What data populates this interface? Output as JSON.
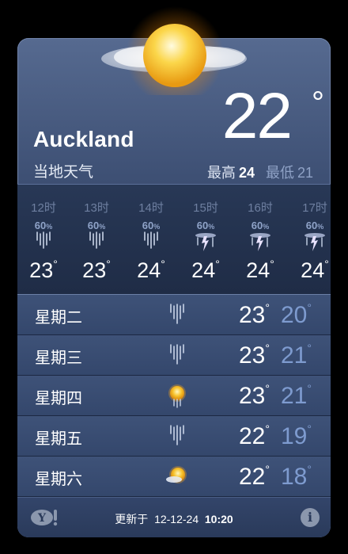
{
  "header": {
    "city": "Auckland",
    "subtitle": "当地天气",
    "temperature": "22",
    "degree_symbol": "°",
    "high_label": "最高",
    "high_value": "24",
    "low_label": "最低",
    "low_value": "21",
    "condition_icon": "partly-cloudy-sun-icon"
  },
  "hourly": [
    {
      "time": "12时",
      "chance": "60",
      "pct": "%",
      "temp": "23",
      "deg": "°",
      "icon": "rain-icon"
    },
    {
      "time": "13时",
      "chance": "60",
      "pct": "%",
      "temp": "23",
      "deg": "°",
      "icon": "rain-icon"
    },
    {
      "time": "14时",
      "chance": "60",
      "pct": "%",
      "temp": "24",
      "deg": "°",
      "icon": "rain-icon"
    },
    {
      "time": "15时",
      "chance": "60",
      "pct": "%",
      "temp": "24",
      "deg": "°",
      "icon": "thunderstorm-icon"
    },
    {
      "time": "16时",
      "chance": "60",
      "pct": "%",
      "temp": "24",
      "deg": "°",
      "icon": "thunderstorm-icon"
    },
    {
      "time": "17时",
      "chance": "60",
      "pct": "%",
      "temp": "24",
      "deg": "°",
      "icon": "thunderstorm-icon"
    }
  ],
  "daily": [
    {
      "day": "星期二",
      "high": "23",
      "low": "20",
      "deg": "°",
      "icon": "rain-icon"
    },
    {
      "day": "星期三",
      "high": "23",
      "low": "21",
      "deg": "°",
      "icon": "rain-icon"
    },
    {
      "day": "星期四",
      "high": "23",
      "low": "21",
      "deg": "°",
      "icon": "sun-rain-icon"
    },
    {
      "day": "星期五",
      "high": "22",
      "low": "19",
      "deg": "°",
      "icon": "rain-icon"
    },
    {
      "day": "星期六",
      "high": "22",
      "low": "18",
      "deg": "°",
      "icon": "partly-cloudy-sun-icon"
    }
  ],
  "footer": {
    "brand_icon": "yahoo-logo-icon",
    "updated_label": "更新于",
    "updated_date": "12-12-24",
    "updated_time": "10:20",
    "info_glyph": "i"
  },
  "colors": {
    "background": "#000000",
    "card_top": "#566a90",
    "card_bottom": "#2a3956",
    "low_temp": "#7e9bcf",
    "sun": "#f7c22a"
  }
}
